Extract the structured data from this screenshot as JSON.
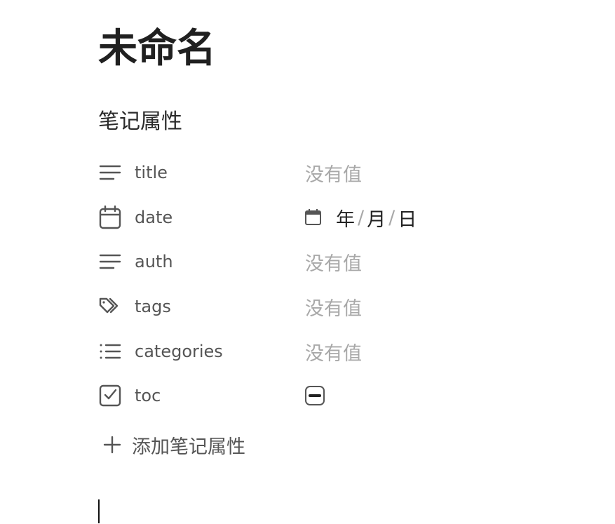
{
  "note": {
    "title": "未命名"
  },
  "properties": {
    "heading": "笔记属性",
    "empty_placeholder": "没有值",
    "items": [
      {
        "key": "title",
        "icon": "text-lines-icon",
        "value": "没有值"
      },
      {
        "key": "date",
        "icon": "calendar-icon",
        "value_parts": [
          "年",
          "/",
          "月",
          "/",
          "日"
        ]
      },
      {
        "key": "auth",
        "icon": "text-lines-icon",
        "value": "没有值"
      },
      {
        "key": "tags",
        "icon": "tags-icon",
        "value": "没有值"
      },
      {
        "key": "categories",
        "icon": "list-icon",
        "value": "没有值"
      },
      {
        "key": "toc",
        "icon": "checkbox-icon",
        "value_state": "indeterminate"
      }
    ],
    "add_label": "添加笔记属性"
  },
  "colors": {
    "text": "#222222",
    "muted": "#a8a8a8",
    "icon": "#555555"
  }
}
